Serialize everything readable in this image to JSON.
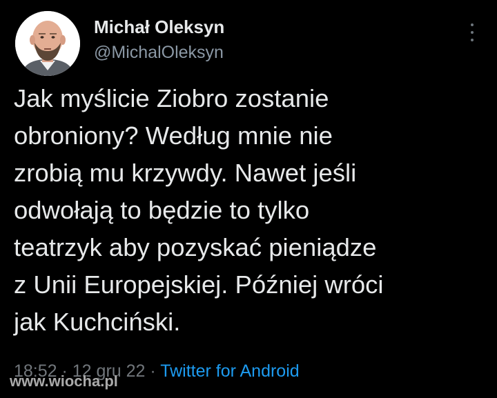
{
  "colors": {
    "background": "#000000",
    "text": "#e7e9ea",
    "muted": "#71767b",
    "link": "#1d9bf0"
  },
  "author": {
    "display_name": "Michał Oleksyn",
    "handle": "@MichalOleksyn",
    "avatar_icon": "profile-photo"
  },
  "menu": {
    "icon": "more-vertical-icon"
  },
  "tweet": {
    "text": "Jak myślicie Ziobro zostanie\nobroniony? Według mnie nie\nzrobią mu krzywdy. Nawet jeśli\nodwołają to będzie to tylko\nteatrzyk aby pozyskać pieniądze\nz Unii Europejskiej. Później wróci\njak Kuchciński."
  },
  "meta": {
    "time": "18:52",
    "separator1": " · ",
    "date": "12 gru 22",
    "separator2": " · ",
    "source": "Twitter for Android"
  },
  "watermark": {
    "text": "www.wiocha.pl"
  }
}
